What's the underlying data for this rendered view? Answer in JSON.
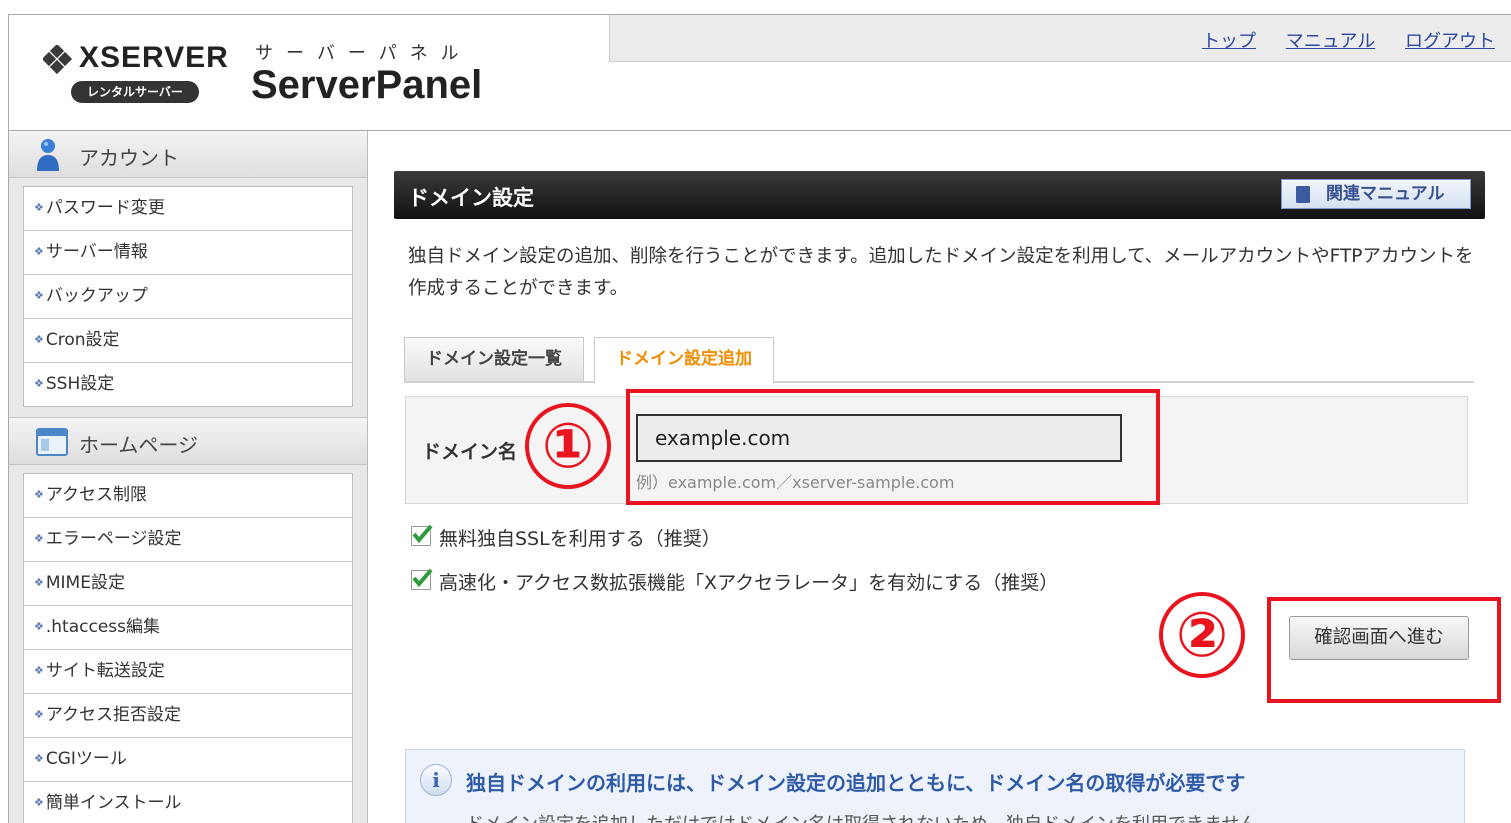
{
  "header": {
    "brand": "XSERVER",
    "brand_sub": "レンタルサーバー",
    "panel_kana": "サーバーパネル",
    "panel_name": "ServerPanel",
    "links": [
      "トップ",
      "マニュアル",
      "ログアウト"
    ]
  },
  "sidebar": {
    "sections": [
      {
        "title": "アカウント",
        "icon": "user-icon",
        "items": [
          "パスワード変更",
          "サーバー情報",
          "バックアップ",
          "Cron設定",
          "SSH設定"
        ]
      },
      {
        "title": "ホームページ",
        "icon": "window-icon",
        "items": [
          "アクセス制限",
          "エラーページ設定",
          "MIME設定",
          ".htaccess編集",
          "サイト転送設定",
          "アクセス拒否設定",
          "CGIツール",
          "簡単インストール"
        ]
      }
    ]
  },
  "main": {
    "title": "ドメイン設定",
    "manual_button": "関連マニュアル",
    "description": "独自ドメイン設定の追加、削除を行うことができます。追加したドメイン設定を利用して、メールアカウントやFTPアカウントを作成することができます。",
    "tabs": [
      {
        "label": "ドメイン設定一覧",
        "active": false
      },
      {
        "label": "ドメイン設定追加",
        "active": true
      }
    ],
    "form": {
      "label": "ドメイン名",
      "value": "example.com",
      "hint": "例）example.com／xserver-sample.com"
    },
    "checkboxes": [
      {
        "label": "無料独自SSLを利用する（推奨）",
        "checked": true
      },
      {
        "label": "高速化・アクセス数拡張機能「Xアクセラレータ」を有効にする（推奨）",
        "checked": true
      }
    ],
    "confirm_button": "確認画面へ進む",
    "info": {
      "heading": "独自ドメインの利用には、ドメイン設定の追加とともに、ドメイン名の取得が必要です",
      "body": "ドメイン設定を追加しただけではドメイン名は取得されないため、独自ドメインを利用できません"
    }
  },
  "annotations": {
    "step1": "①",
    "step2": "②",
    "color": "#e8141e"
  }
}
